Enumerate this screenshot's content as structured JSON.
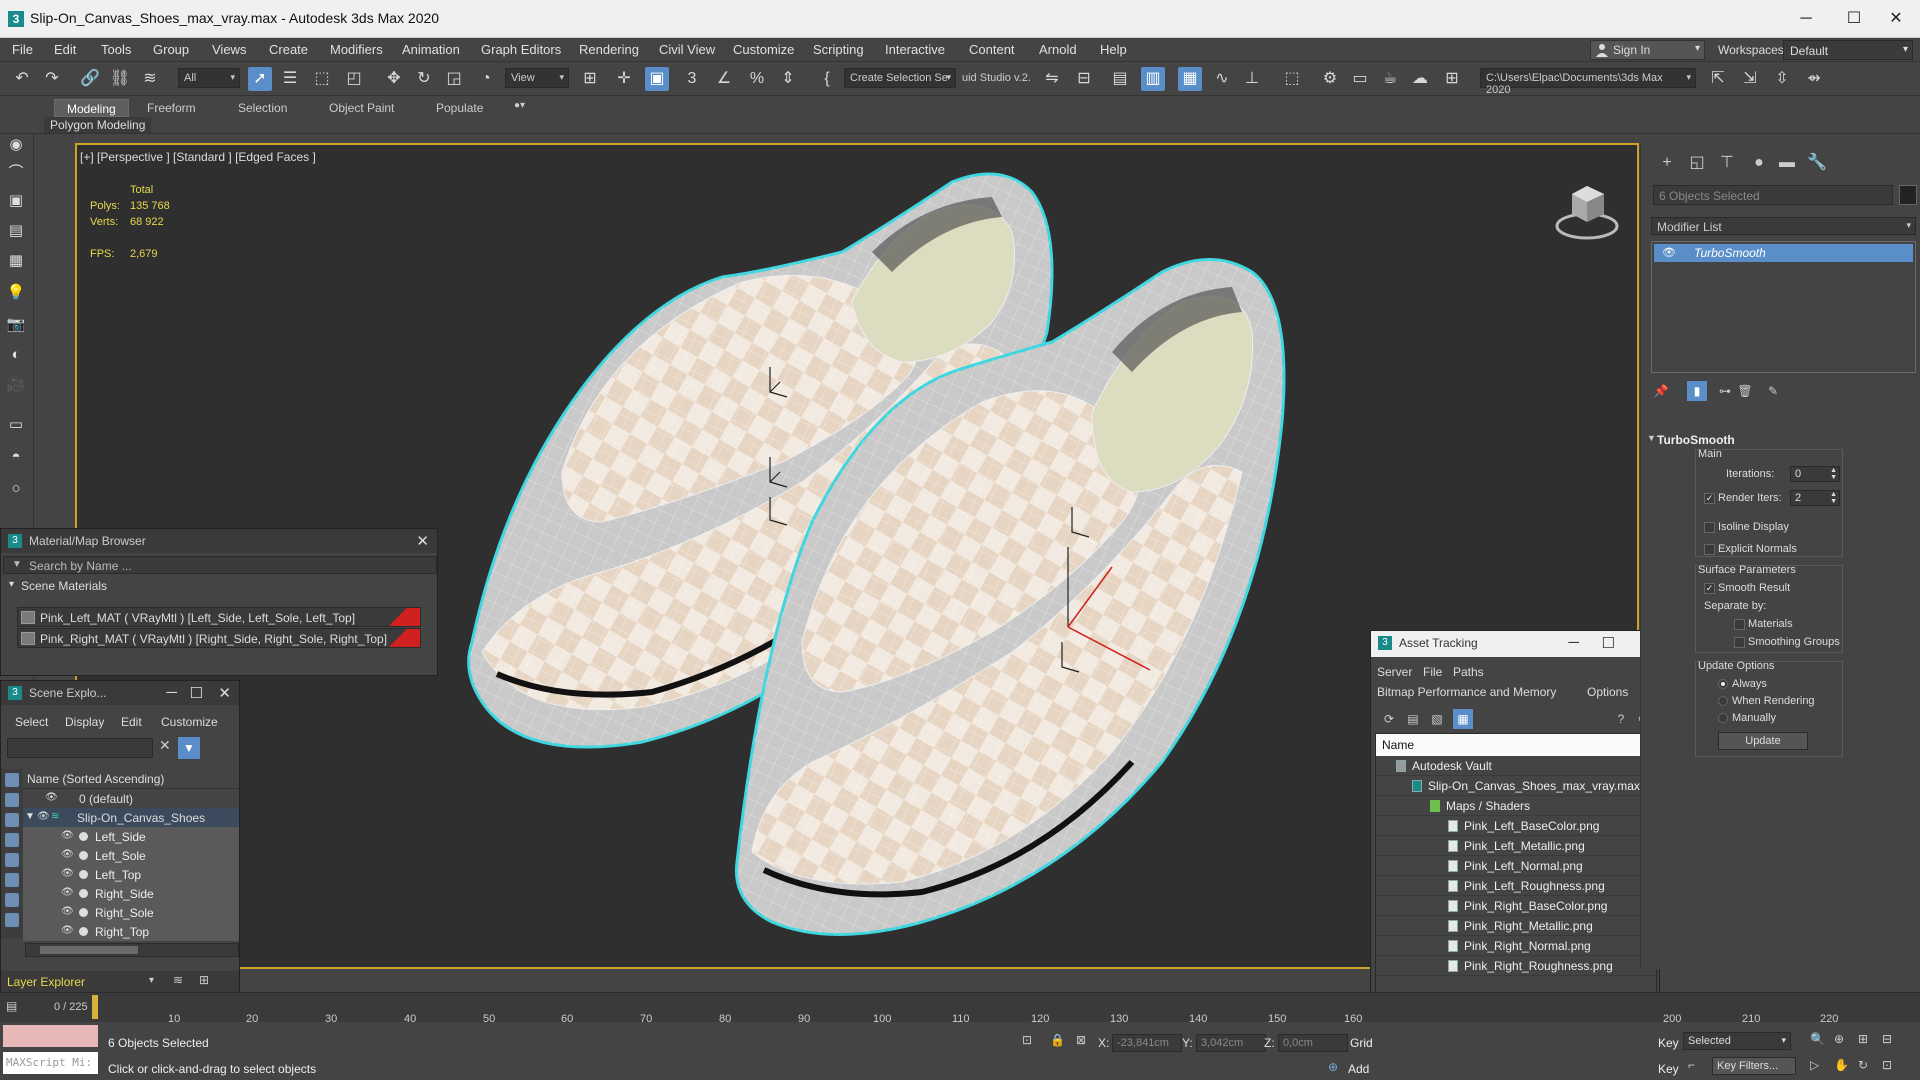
{
  "window": {
    "title": "Slip-On_Canvas_Shoes_max_vray.max - Autodesk 3ds Max 2020",
    "minimize": "─",
    "maximize": "☐",
    "close": "✕"
  },
  "menu": [
    "File",
    "Edit",
    "Tools",
    "Group",
    "Views",
    "Create",
    "Modifiers",
    "Animation",
    "Graph Editors",
    "Rendering",
    "Civil View",
    "Customize",
    "Scripting",
    "Interactive",
    "Content",
    "Arnold",
    "Help"
  ],
  "account": {
    "signin": "Sign In",
    "workspaces_label": "Workspaces:",
    "workspace": "Default"
  },
  "toolbar": {
    "filter": "All",
    "ref_coord": "View",
    "selection_set": "Create Selection Se",
    "studio_text": "uid Studio v.2.",
    "project_path": "C:\\Users\\Elpac\\Documents\\3ds Max 2020"
  },
  "ribbon": {
    "tabs": [
      "Modeling",
      "Freeform",
      "Selection",
      "Object Paint",
      "Populate"
    ],
    "sub_label": "Polygon Modeling",
    "toggle": "●▾"
  },
  "viewport": {
    "label": "[+] [Perspective ] [Standard ] [Edged Faces ]",
    "stats": {
      "total": "Total",
      "polys_label": "Polys:",
      "polys": "135 768",
      "verts_label": "Verts:",
      "verts": "68 922",
      "fps_label": "FPS:",
      "fps": "2,679"
    }
  },
  "material_browser": {
    "title": "Material/Map Browser",
    "search": "Search by Name ...",
    "section": "Scene Materials",
    "items": [
      "Pink_Left_MAT  ( VRayMtl ) [Left_Side, Left_Sole, Left_Top]",
      "Pink_Right_MAT  ( VRayMtl ) [Right_Side, Right_Sole, Right_Top]"
    ]
  },
  "scene_explorer": {
    "title": "Scene Explo...",
    "menu": [
      "Select",
      "Display",
      "Edit",
      "Customize"
    ],
    "header": "Name (Sorted Ascending)",
    "default_layer": "0 (default)",
    "group": "Slip-On_Canvas_Shoes",
    "objects": [
      "Left_Side",
      "Left_Sole",
      "Left_Top",
      "Right_Side",
      "Right_Sole",
      "Right_Top"
    ],
    "footer": "Layer Explorer"
  },
  "asset_tracking": {
    "title": "Asset Tracking",
    "menu1": [
      "Server",
      "File",
      "Paths"
    ],
    "menu2": [
      "Bitmap Performance and Memory",
      "Options"
    ],
    "header": "Name",
    "vault": "Autodesk Vault",
    "file": "Slip-On_Canvas_Shoes_max_vray.max",
    "folder": "Maps / Shaders",
    "maps": [
      "Pink_Left_BaseColor.png",
      "Pink_Left_Metallic.png",
      "Pink_Left_Normal.png",
      "Pink_Left_Roughness.png",
      "Pink_Right_BaseColor.png",
      "Pink_Right_Metallic.png",
      "Pink_Right_Normal.png",
      "Pink_Right_Roughness.png"
    ]
  },
  "command_panel": {
    "selection": "6 Objects Selected",
    "modifier_list": "Modifier List",
    "modifier": "TurboSmooth",
    "rollout_title": "TurboSmooth",
    "main": "Main",
    "iterations_label": "Iterations:",
    "iterations": "0",
    "render_iters_label": "Render Iters:",
    "render_iters": "2",
    "isoline": "Isoline Display",
    "explicit_normals": "Explicit Normals",
    "surface_params": "Surface Parameters",
    "smooth_result": "Smooth Result",
    "separate_by": "Separate by:",
    "materials": "Materials",
    "smoothing_groups": "Smoothing Groups",
    "update_options": "Update Options",
    "always": "Always",
    "when_rendering": "When Rendering",
    "manually": "Manually",
    "update_btn": "Update"
  },
  "timeline": {
    "ticks": [
      "10",
      "20",
      "30",
      "40",
      "50",
      "60",
      "70",
      "80",
      "90",
      "100",
      "110",
      "120",
      "130",
      "140",
      "150",
      "160",
      "200",
      "210",
      "220"
    ],
    "frame_label": "0 / 225"
  },
  "status": {
    "selected": "6 Objects Selected",
    "prompt": "Click or click-and-drag to select objects",
    "maxscript": "MAXScript Mi:",
    "x_label": "X:",
    "x": "-23,841cm",
    "y_label": "Y:",
    "y": "3,042cm",
    "z_label": "Z:",
    "z": "0,0cm",
    "grid": "Grid",
    "add": "Add",
    "key": "Key",
    "key_mode": "Selected",
    "key_filters": "Key Filters...",
    "key2": "Key"
  },
  "colors": {
    "accent": "#5a8ec9",
    "viewport_border": "#c9a227",
    "stats": "#e6d94a",
    "outline": "#3fd6e0"
  }
}
